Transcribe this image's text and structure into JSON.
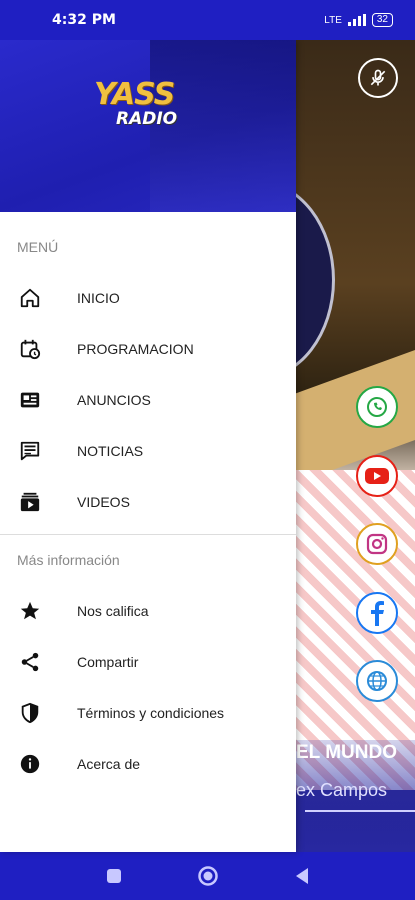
{
  "status_bar": {
    "time": "4:32 PM",
    "network": "LTE",
    "battery": "32"
  },
  "drawer": {
    "brand": {
      "name": "YASS",
      "sub": "RADIO"
    },
    "menu_title": "MENÚ",
    "menu_items": [
      {
        "label": "INICIO",
        "icon": "home-icon"
      },
      {
        "label": "PROGRAMACION",
        "icon": "schedule-icon"
      },
      {
        "label": "ANUNCIOS",
        "icon": "ads-icon"
      },
      {
        "label": "NOTICIAS",
        "icon": "news-icon"
      },
      {
        "label": "VIDEOS",
        "icon": "video-icon"
      }
    ],
    "more_title": "Más información",
    "more_items": [
      {
        "label": "Nos califica",
        "icon": "star-icon"
      },
      {
        "label": "Compartir",
        "icon": "share-icon"
      },
      {
        "label": "Términos y condiciones",
        "icon": "shield-icon"
      },
      {
        "label": "Acerca de",
        "icon": "info-icon"
      }
    ]
  },
  "background": {
    "headline": "EL MUNDO",
    "subline": "ex Campos"
  },
  "social": [
    {
      "name": "whatsapp",
      "icon": "whatsapp-icon",
      "color": "#25a845"
    },
    {
      "name": "youtube",
      "icon": "youtube-icon",
      "color": "#e62117"
    },
    {
      "name": "instagram",
      "icon": "instagram-icon",
      "color": "#c13584"
    },
    {
      "name": "facebook",
      "icon": "facebook-icon",
      "color": "#1877f2"
    },
    {
      "name": "web",
      "icon": "globe-icon",
      "color": "#2a8bd8"
    }
  ],
  "colors": {
    "primary": "#1f1fc2",
    "accent": "#f0c040"
  }
}
